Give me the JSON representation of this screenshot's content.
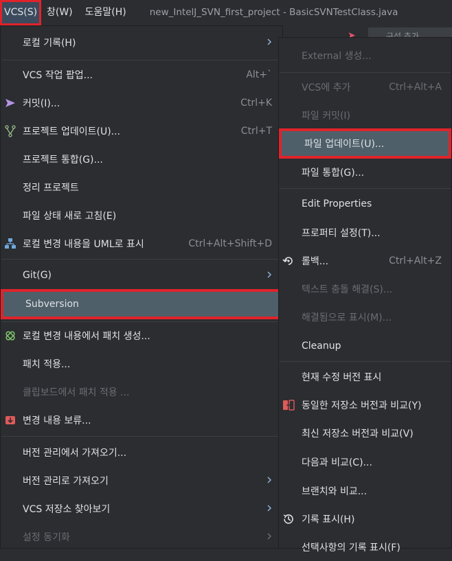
{
  "menubar": {
    "vcs": "VCS(S)",
    "window": "창(W)",
    "help": "도움말(H)",
    "title": "new_IntelJ_SVN_first_project - BasicSVNTestClass.java",
    "bg_tab": "구성 추가"
  },
  "left_menu": {
    "local_history": "로컬 기록(H)",
    "vcs_popup": "VCS 작업 팝업...",
    "vcs_popup_sc": "Alt+`",
    "commit": "커밋(I)...",
    "commit_sc": "Ctrl+K",
    "update_project": "프로젝트 업데이트(U)...",
    "update_project_sc": "Ctrl+T",
    "integrate_project": "프로젝트 통합(G)...",
    "cleanup_project": "정리 프로젝트",
    "refresh_status": "파일 상태 새로 고침(E)",
    "show_uml": "로컬 변경 내용을 UML로 표시",
    "show_uml_sc": "Ctrl+Alt+Shift+D",
    "git": "Git(G)",
    "subversion": "Subversion",
    "create_patch": "로컬 변경 내용에서 패치 생성...",
    "apply_patch": "패치 적용...",
    "apply_clipboard_patch": "클립보드에서 패치 적용 ...",
    "shelve": "변경 내용 보류...",
    "get_from_vcs": "버전 관리에서 가져오기...",
    "import_into_vcs": "버전 관리로 가져오기",
    "browse_vcs": "VCS 저장소 찾아보기",
    "sync_settings": "설정 동기화"
  },
  "right_menu": {
    "external_create": "External 생성...",
    "add_to_vcs": "VCS에 추가",
    "add_to_vcs_sc": "Ctrl+Alt+A",
    "commit_file": "파일 커밋(I)",
    "update_file": "파일 업데이트(U)...",
    "integrate_file": "파일 통합(G)...",
    "edit_properties": "Edit Properties",
    "set_property": "프로퍼티 설정(T)...",
    "rollback": "롤백...",
    "rollback_sc": "Ctrl+Alt+Z",
    "resolve_text_conflict": "텍스트 충돌 해결(S)...",
    "mark_resolved": "해결됨으로 표시(M)...",
    "cleanup": "Cleanup",
    "show_current_revision": "현재 수정 버전 표시",
    "compare_same_repo": "동일한 저장소 버전과 비교(Y)",
    "compare_latest_repo": "최신 저장소 버전과 비교(V)",
    "compare_with": "다음과 비교(C)...",
    "compare_branch": "브랜치와 비교...",
    "show_history": "기록 표시(H)",
    "show_selection_history": "선택사항의 기록 표시(F)"
  },
  "colors": {
    "menu_bg": "#2b2d30",
    "highlight": "#4e5f69",
    "red_box": "#e0232b",
    "disabled_text": "#6a6d73"
  }
}
